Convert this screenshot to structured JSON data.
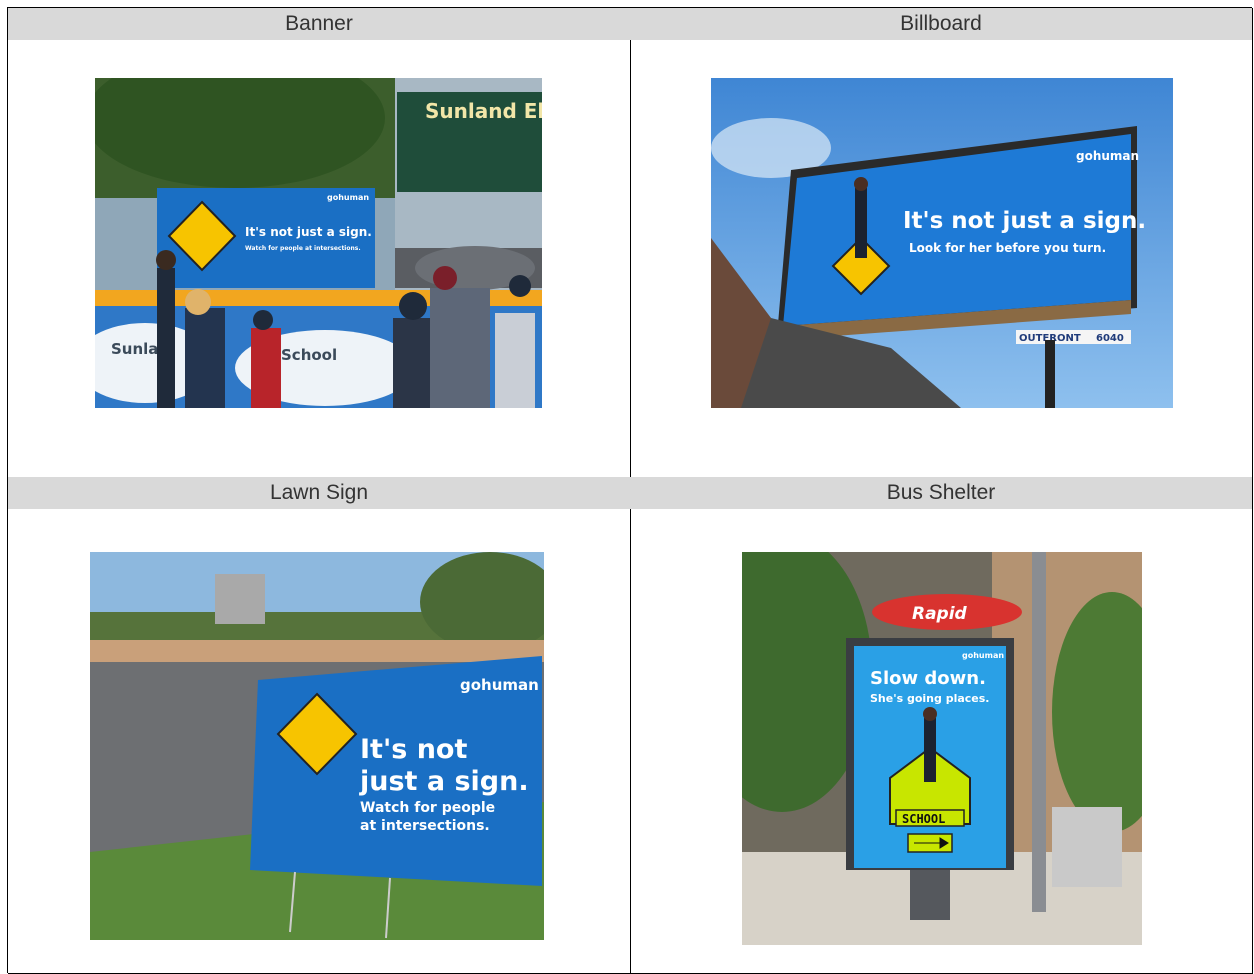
{
  "panels": [
    {
      "title": "Banner",
      "sign": {
        "brand": "gohuman",
        "headline": "It's not just a sign.",
        "subline": "Watch for people at intersections.",
        "school_name": "Sunland Elem",
        "fence_left": "Sunlan",
        "fence_right": "School"
      }
    },
    {
      "title": "Billboard",
      "sign": {
        "brand": "gohuman",
        "headline": "It's not just a sign.",
        "subline": "Look for her before you turn.",
        "vendor": "OUTFRONT",
        "vendor_number": "6040"
      }
    },
    {
      "title": "Lawn Sign",
      "sign": {
        "brand": "gohuman",
        "headline_line1": "It's not",
        "headline_line2": "just a sign.",
        "subline_line1": "Watch for people",
        "subline_line2": "at intersections."
      }
    },
    {
      "title": "Bus Shelter",
      "sign": {
        "brand": "gohuman",
        "rapid": "Rapid",
        "headline": "Slow down.",
        "subline": "She's going places.",
        "school": "SCHOOL"
      }
    }
  ],
  "colors": {
    "header_bg": "#d9d9d9",
    "sign_blue": "#1a6fc4",
    "sign_yellow": "#f7c400",
    "brand_green": "#7ac143",
    "sky": "#5b9bd5"
  }
}
